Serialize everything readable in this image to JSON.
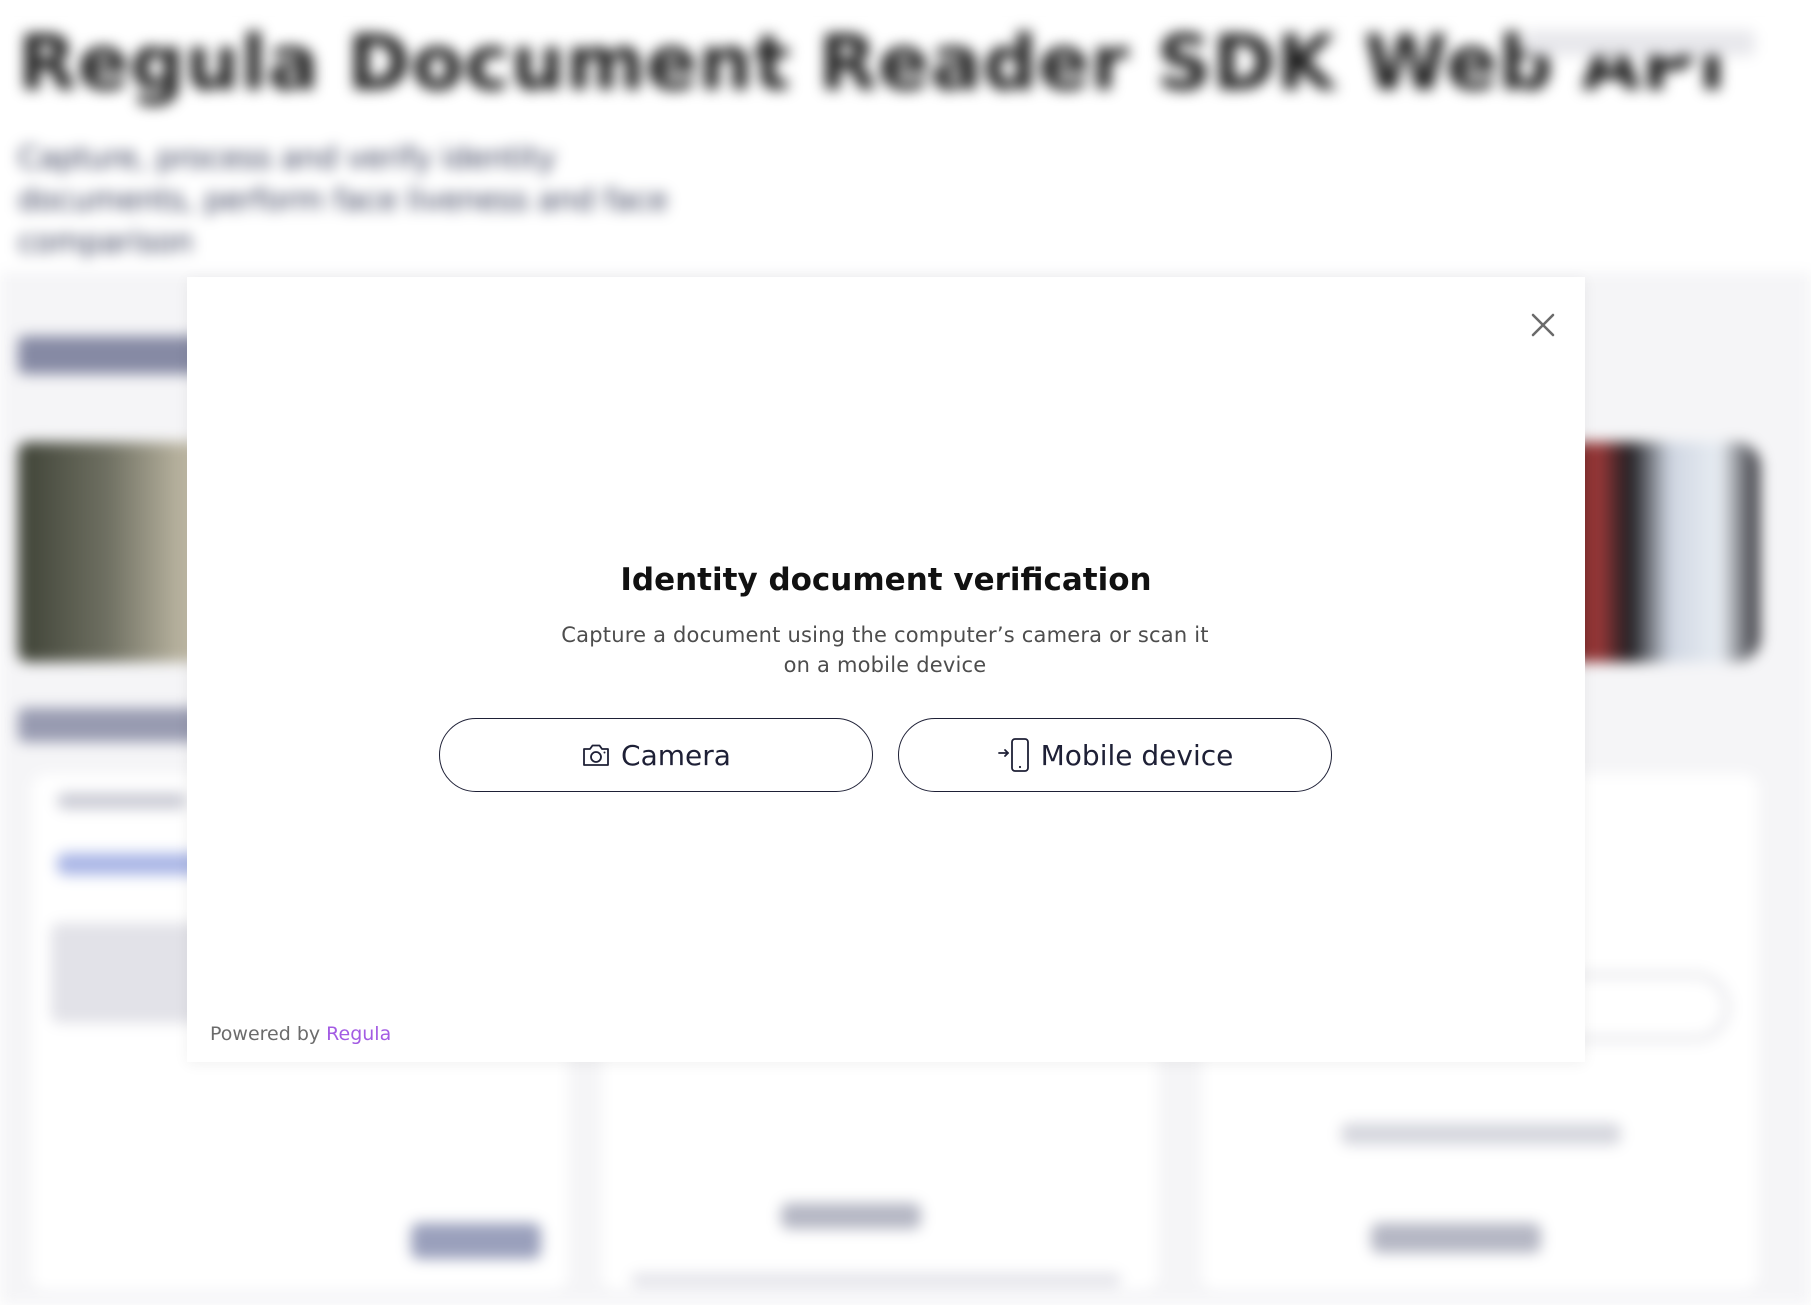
{
  "background": {
    "title": "Regula Document Reader SDK Web API",
    "subtitle": "Capture, process and verify identity documents, perform face liveness and face comparison"
  },
  "modal": {
    "title": "Identity document verification",
    "description": "Capture a document using the computer’s camera or scan it on a mobile device",
    "close_icon": "close-icon",
    "buttons": {
      "camera": {
        "label": "Camera",
        "icon": "camera-icon"
      },
      "mobile": {
        "label": "Mobile device",
        "icon": "mobile-device-icon"
      }
    },
    "footer": {
      "powered_by": "Powered by",
      "brand": "Regula",
      "brand_color": "#a35be3"
    }
  },
  "colors": {
    "button_border": "#1e2036",
    "title_text": "#111111",
    "description_text": "#4d4d4d"
  }
}
